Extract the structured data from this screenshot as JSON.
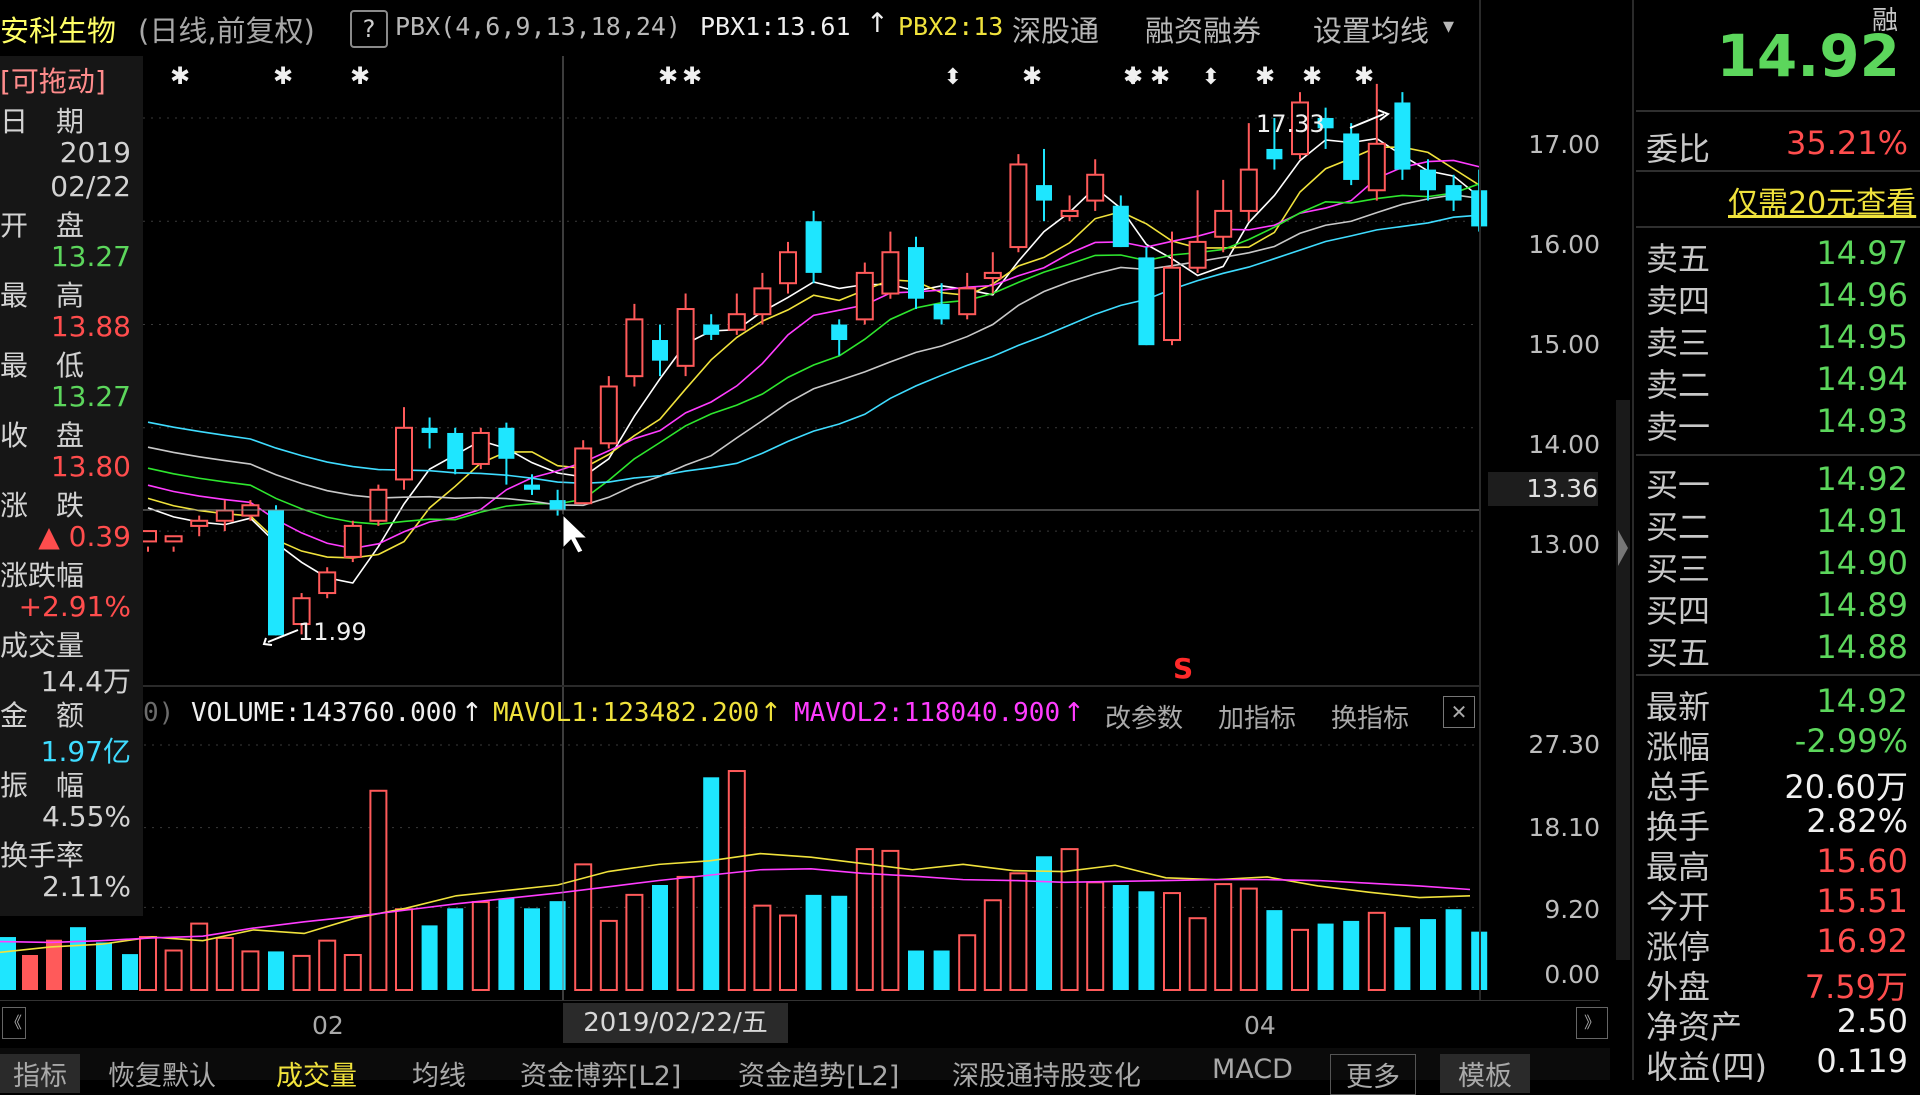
{
  "header": {
    "stock_name": "安科生物",
    "period": "(日线,前复权)",
    "help": "?",
    "indicator_params": "PBX(4,6,9,13,18,24)",
    "pbx1": "PBX1:13.61",
    "pbx2": "PBX2:13",
    "sgt": "深股通",
    "margin": "融资融券",
    "set_ma": "设置均线",
    "up_arrow": "↑",
    "dropdown": "▾"
  },
  "info_panel": {
    "draggable": "[可拖动]",
    "date_label": "日　期",
    "year": "2019",
    "date": "02/22",
    "open_label": "开　盘",
    "open": "13.27",
    "high_label": "最　高",
    "high": "13.88",
    "low_label": "最　低",
    "low": "13.27",
    "close_label": "收　盘",
    "close": "13.80",
    "change_label": "涨　跌",
    "change": "▲ 0.39",
    "pct_label": "涨跌幅",
    "pct": "+2.91%",
    "vol_label": "成交量",
    "vol": "14.4万",
    "amount_label": "金　额",
    "amount": "1.97亿",
    "amp_label": "振　幅",
    "amp": "4.55%",
    "turnover_label": "换手率",
    "turnover": "2.11%"
  },
  "price_axis": [
    "17.00",
    "16.00",
    "15.00",
    "14.00",
    "13.00"
  ],
  "crosshair_price": "13.36",
  "annotations": {
    "high": "17.33",
    "low": "11.99",
    "s_marker": "S"
  },
  "volume_header": {
    "prefix": "0)",
    "volume": "VOLUME:143760.000",
    "mavol1": "MAVOL1:123482.200",
    "mavol2": "MAVOL2:118040.900",
    "edit_params": "改参数",
    "add_indicator": "加指标",
    "switch_indicator": "换指标",
    "close": "✕",
    "arrow": "↑"
  },
  "volume_axis": [
    "27.30",
    "18.10",
    "9.20",
    "0.00"
  ],
  "x_axis": {
    "left": "02",
    "right": "04",
    "crosshair_date": "2019/02/22/五",
    "prev": "《",
    "next": "》"
  },
  "bottom_tabs": [
    "指标",
    "恢复默认",
    "成交量",
    "均线",
    "资金博弈[L2]",
    "资金趋势[L2]",
    "深股通持股变化",
    "MACD",
    "更多",
    "模板"
  ],
  "right_panel": {
    "margin_tag": "融",
    "last_price": "14.92",
    "weibi_label": "委比",
    "weibi": "35.21%",
    "promo": "仅需20元查看",
    "sell": [
      {
        "label": "卖五",
        "price": "14.97"
      },
      {
        "label": "卖四",
        "price": "14.96"
      },
      {
        "label": "卖三",
        "price": "14.95"
      },
      {
        "label": "卖二",
        "price": "14.94"
      },
      {
        "label": "卖一",
        "price": "14.93"
      }
    ],
    "buy": [
      {
        "label": "买一",
        "price": "14.92"
      },
      {
        "label": "买二",
        "price": "14.91"
      },
      {
        "label": "买三",
        "price": "14.90"
      },
      {
        "label": "买四",
        "price": "14.89"
      },
      {
        "label": "买五",
        "price": "14.88"
      }
    ],
    "stats": [
      {
        "label": "最新",
        "value": "14.92",
        "color": "#5cd65c"
      },
      {
        "label": "涨幅",
        "value": "-2.99%",
        "color": "#5cd65c"
      },
      {
        "label": "总手",
        "value": "20.60万",
        "color": "#f0f0f0"
      },
      {
        "label": "换手",
        "value": "2.82%",
        "color": "#f0f0f0"
      },
      {
        "label": "最高",
        "value": "15.60",
        "color": "#ff4d4d"
      },
      {
        "label": "今开",
        "value": "15.51",
        "color": "#ff4d4d"
      },
      {
        "label": "涨停",
        "value": "16.92",
        "color": "#ff4d4d"
      },
      {
        "label": "外盘",
        "value": "7.59万",
        "color": "#ff4d4d"
      },
      {
        "label": "净资产",
        "value": "2.50",
        "color": "#f0f0f0"
      },
      {
        "label": "收益(四)",
        "value": "0.119",
        "color": "#f0f0f0"
      }
    ]
  },
  "chart_data": {
    "type": "candlestick",
    "price_range": [
      11.5,
      17.6
    ],
    "volume_range": [
      0,
      27.3
    ],
    "candles": [
      [
        12.9,
        13.0,
        12.85,
        12.8
      ],
      [
        12.9,
        12.95,
        12.85,
        12.8
      ],
      [
        13.05,
        13.1,
        13.15,
        12.95
      ],
      [
        13.1,
        13.2,
        13.3,
        13.0
      ],
      [
        13.15,
        13.25,
        13.3,
        13.1
      ],
      [
        13.2,
        11.99,
        13.25,
        11.99
      ],
      [
        12.1,
        12.35,
        12.4,
        12.0
      ],
      [
        12.4,
        12.6,
        12.65,
        12.35
      ],
      [
        12.75,
        13.05,
        13.1,
        12.7
      ],
      [
        13.1,
        13.4,
        13.45,
        13.05
      ],
      [
        13.5,
        14.0,
        14.2,
        13.4
      ],
      [
        14.0,
        13.95,
        14.1,
        13.8
      ],
      [
        13.95,
        13.6,
        14.0,
        13.55
      ],
      [
        13.65,
        13.95,
        14.0,
        13.6
      ],
      [
        14.0,
        13.7,
        14.05,
        13.45
      ],
      [
        13.45,
        13.4,
        13.55,
        13.35
      ],
      [
        13.3,
        13.2,
        13.4,
        13.15
      ],
      [
        13.27,
        13.8,
        13.88,
        13.27
      ],
      [
        13.85,
        14.4,
        14.5,
        13.8
      ],
      [
        14.5,
        15.05,
        15.2,
        14.4
      ],
      [
        14.85,
        14.65,
        15.0,
        14.5
      ],
      [
        14.6,
        15.15,
        15.3,
        14.5
      ],
      [
        15.0,
        14.9,
        15.1,
        14.85
      ],
      [
        14.95,
        15.1,
        15.3,
        14.9
      ],
      [
        15.1,
        15.35,
        15.5,
        15.0
      ],
      [
        15.4,
        15.7,
        15.8,
        15.3
      ],
      [
        16.0,
        15.5,
        16.1,
        15.4
      ],
      [
        15.0,
        14.85,
        15.05,
        14.7
      ],
      [
        15.05,
        15.5,
        15.6,
        15.0
      ],
      [
        15.3,
        15.7,
        15.9,
        15.25
      ],
      [
        15.75,
        15.25,
        15.85,
        15.15
      ],
      [
        15.2,
        15.05,
        15.4,
        15.0
      ],
      [
        15.1,
        15.35,
        15.5,
        15.05
      ],
      [
        15.45,
        15.5,
        15.7,
        15.3
      ],
      [
        15.75,
        16.55,
        16.65,
        15.7
      ],
      [
        16.35,
        16.2,
        16.7,
        16.0
      ],
      [
        16.05,
        16.1,
        16.25,
        16.0
      ],
      [
        16.2,
        16.45,
        16.6,
        16.1
      ],
      [
        16.15,
        15.75,
        16.25,
        15.75
      ],
      [
        15.65,
        14.8,
        15.75,
        14.8
      ],
      [
        14.85,
        15.55,
        15.9,
        14.8
      ],
      [
        15.55,
        15.8,
        16.3,
        15.5
      ],
      [
        15.85,
        16.1,
        16.4,
        15.7
      ],
      [
        16.1,
        16.5,
        16.95,
        16.0
      ],
      [
        16.7,
        16.6,
        17.0,
        16.5
      ],
      [
        16.65,
        17.15,
        17.25,
        16.6
      ],
      [
        17.0,
        16.9,
        17.1,
        16.7
      ],
      [
        16.85,
        16.4,
        16.95,
        16.35
      ],
      [
        16.3,
        16.75,
        17.33,
        16.2
      ],
      [
        17.15,
        16.5,
        17.25,
        16.4
      ],
      [
        16.5,
        16.3,
        16.6,
        16.2
      ],
      [
        16.35,
        16.2,
        16.45,
        16.1
      ],
      [
        16.3,
        15.95,
        16.5,
        15.9
      ]
    ],
    "volumes": [
      5.9,
      4.4,
      7.4,
      5.8,
      4.3,
      4.3,
      3.8,
      5.5,
      3.9,
      22.2,
      9.0,
      7.2,
      9.1,
      9.8,
      10.2,
      9.1,
      9.9,
      14.0,
      7.7,
      10.6,
      11.7,
      12.6,
      23.7,
      24.4,
      9.4,
      8.3,
      10.6,
      10.5,
      15.7,
      15.5,
      4.4,
      4.4,
      6.1,
      10.0,
      13.0,
      14.9,
      15.7,
      12.0,
      11.7,
      11.0,
      10.8,
      8.0,
      11.8,
      11.3,
      8.9,
      6.7,
      7.4,
      7.7,
      8.6,
      7.0,
      7.9,
      9.0,
      6.5
    ],
    "mavol1": [
      4.2,
      4.8,
      5.1,
      5.9,
      5.5,
      6.7,
      6.3,
      8.0,
      9.1,
      10.5,
      11.1,
      11.7,
      13.2,
      14.0,
      14.4,
      15.2,
      14.8,
      14.1,
      13.4,
      14.0,
      13.3,
      13.2,
      13.9,
      12.5,
      12.3,
      12.6,
      11.6,
      10.9,
      10.3,
      10.5
    ],
    "mavol2": [
      5.4,
      5.3,
      5.5,
      5.8,
      6.0,
      6.9,
      7.6,
      8.2,
      8.9,
      9.6,
      10.2,
      10.8,
      11.5,
      12.2,
      12.8,
      13.4,
      13.5,
      13.0,
      12.7,
      12.3,
      12.2,
      12.0,
      12.1,
      12.2,
      12.3,
      12.3,
      12.2,
      11.9,
      11.6,
      11.2
    ]
  }
}
